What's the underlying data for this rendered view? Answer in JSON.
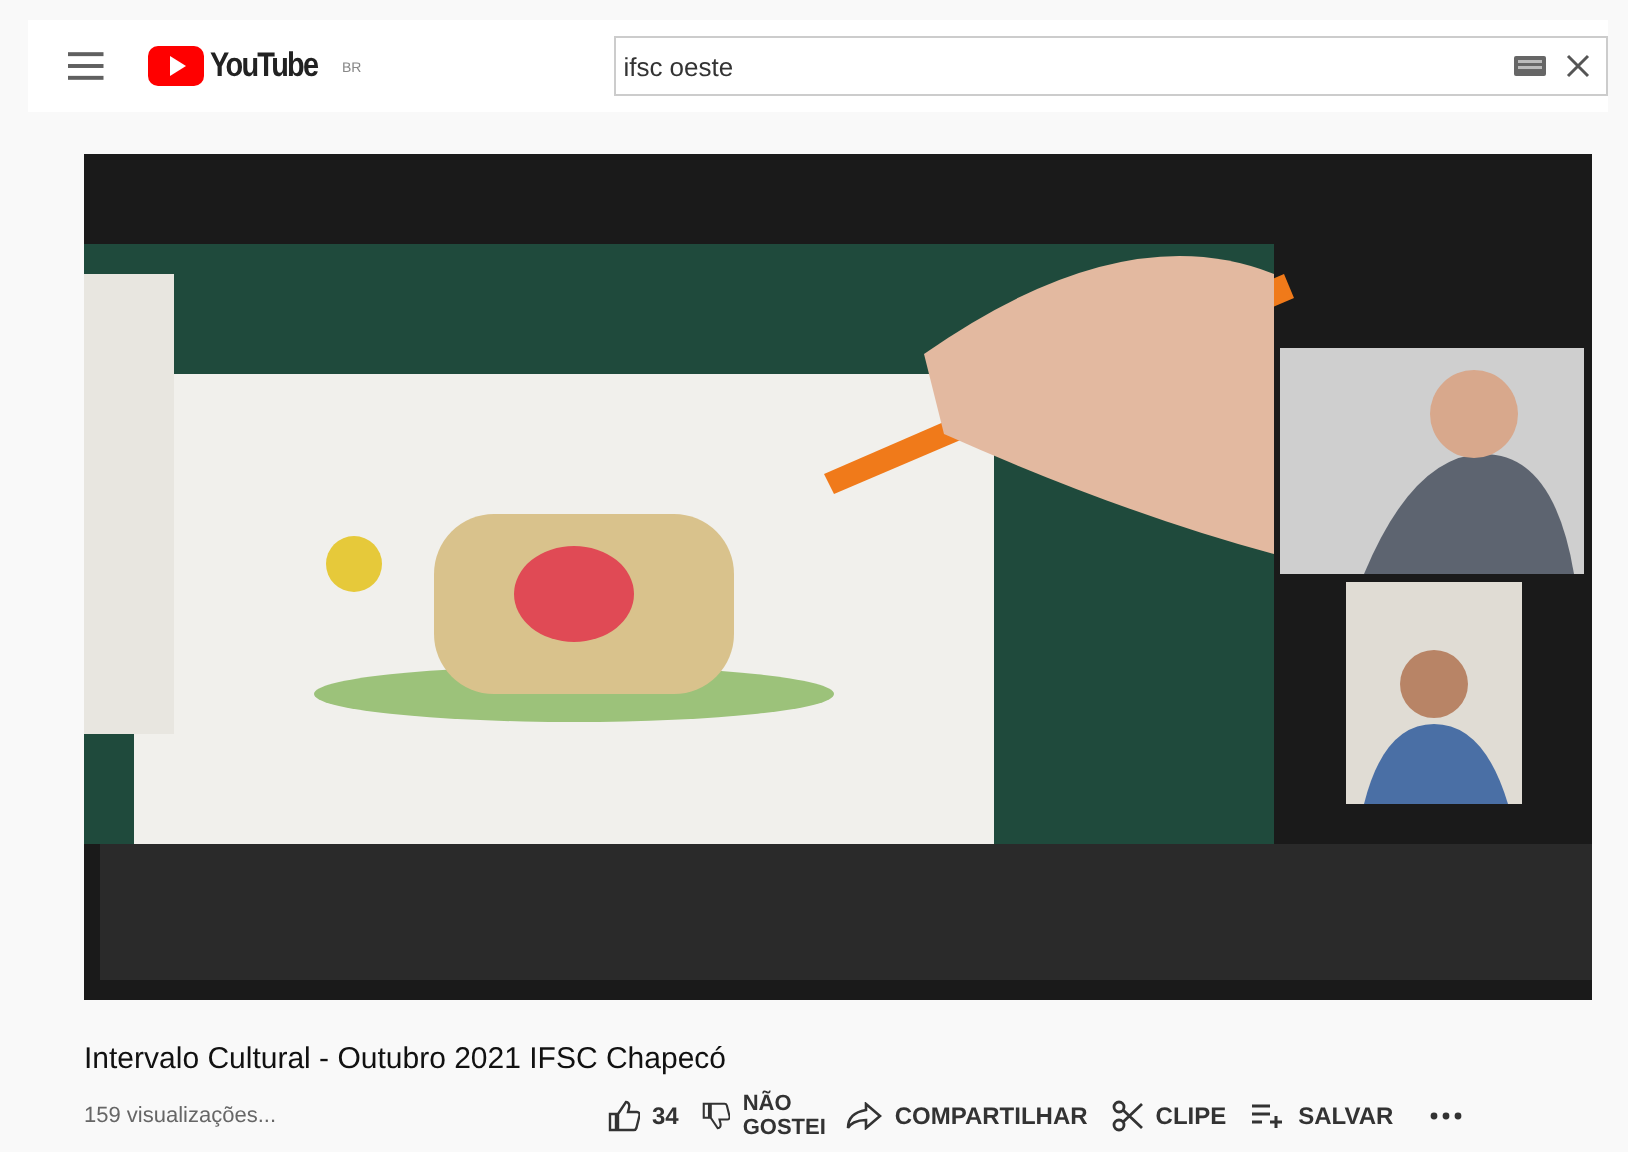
{
  "logo": {
    "text": "YouTube",
    "region": "BR"
  },
  "search": {
    "value": "ifsc oeste"
  },
  "title": "Intervalo Cultural - Outubro 2021 IFSC Chapecó",
  "views": "159 visualizações...",
  "actions": [
    {
      "kind": "like",
      "label": "34"
    },
    {
      "kind": "dislike",
      "label": "NÃO GOSTEI"
    },
    {
      "kind": "share",
      "label": "COMPARTILHAR"
    },
    {
      "kind": "clip",
      "label": "CLIPE"
    },
    {
      "kind": "save",
      "label": "SALVAR"
    },
    {
      "kind": "more"
    }
  ]
}
